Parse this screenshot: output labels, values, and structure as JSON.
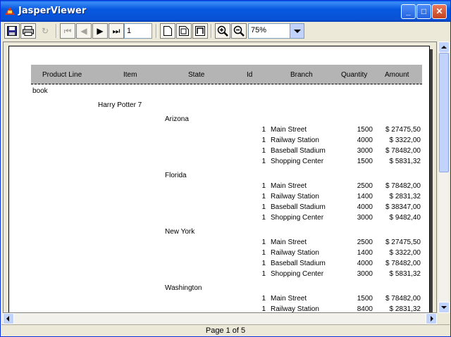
{
  "window": {
    "title": "JasperViewer"
  },
  "toolbar": {
    "page_value": "1",
    "zoom_value": "75%"
  },
  "report": {
    "headers": [
      "Product Line",
      "Item",
      "State",
      "Id",
      "Branch",
      "Quantity",
      "Amount"
    ],
    "product_line": "book",
    "item": "Harry Potter 7",
    "states": [
      {
        "name": "Arizona",
        "rows": [
          {
            "id": "1",
            "branch": "Main Street",
            "qty": "1500",
            "amount": "$ 27475,50"
          },
          {
            "id": "1",
            "branch": "Railway Station",
            "qty": "4000",
            "amount": "$ 3322,00"
          },
          {
            "id": "1",
            "branch": "Baseball Stadium",
            "qty": "3000",
            "amount": "$ 78482,00"
          },
          {
            "id": "1",
            "branch": "Shopping Center",
            "qty": "1500",
            "amount": "$ 5831,32"
          }
        ]
      },
      {
        "name": "Florida",
        "rows": [
          {
            "id": "1",
            "branch": "Main Street",
            "qty": "2500",
            "amount": "$ 78482,00"
          },
          {
            "id": "1",
            "branch": "Railway Station",
            "qty": "1400",
            "amount": "$ 2831,32"
          },
          {
            "id": "1",
            "branch": "Baseball Stadium",
            "qty": "4000",
            "amount": "$ 38347,00"
          },
          {
            "id": "1",
            "branch": "Shopping Center",
            "qty": "3000",
            "amount": "$ 9482,40"
          }
        ]
      },
      {
        "name": "New York",
        "rows": [
          {
            "id": "1",
            "branch": "Main Street",
            "qty": "2500",
            "amount": "$ 27475,50"
          },
          {
            "id": "1",
            "branch": "Railway Station",
            "qty": "1400",
            "amount": "$ 3322,00"
          },
          {
            "id": "1",
            "branch": "Baseball Stadium",
            "qty": "4000",
            "amount": "$ 78482,00"
          },
          {
            "id": "1",
            "branch": "Shopping Center",
            "qty": "3000",
            "amount": "$ 5831,32"
          }
        ]
      },
      {
        "name": "Washington",
        "rows": [
          {
            "id": "1",
            "branch": "Main Street",
            "qty": "1500",
            "amount": "$ 78482,00"
          },
          {
            "id": "1",
            "branch": "Railway Station",
            "qty": "8400",
            "amount": "$ 2831,32"
          }
        ]
      }
    ]
  },
  "status": {
    "page_info": "Page 1 of 5"
  }
}
